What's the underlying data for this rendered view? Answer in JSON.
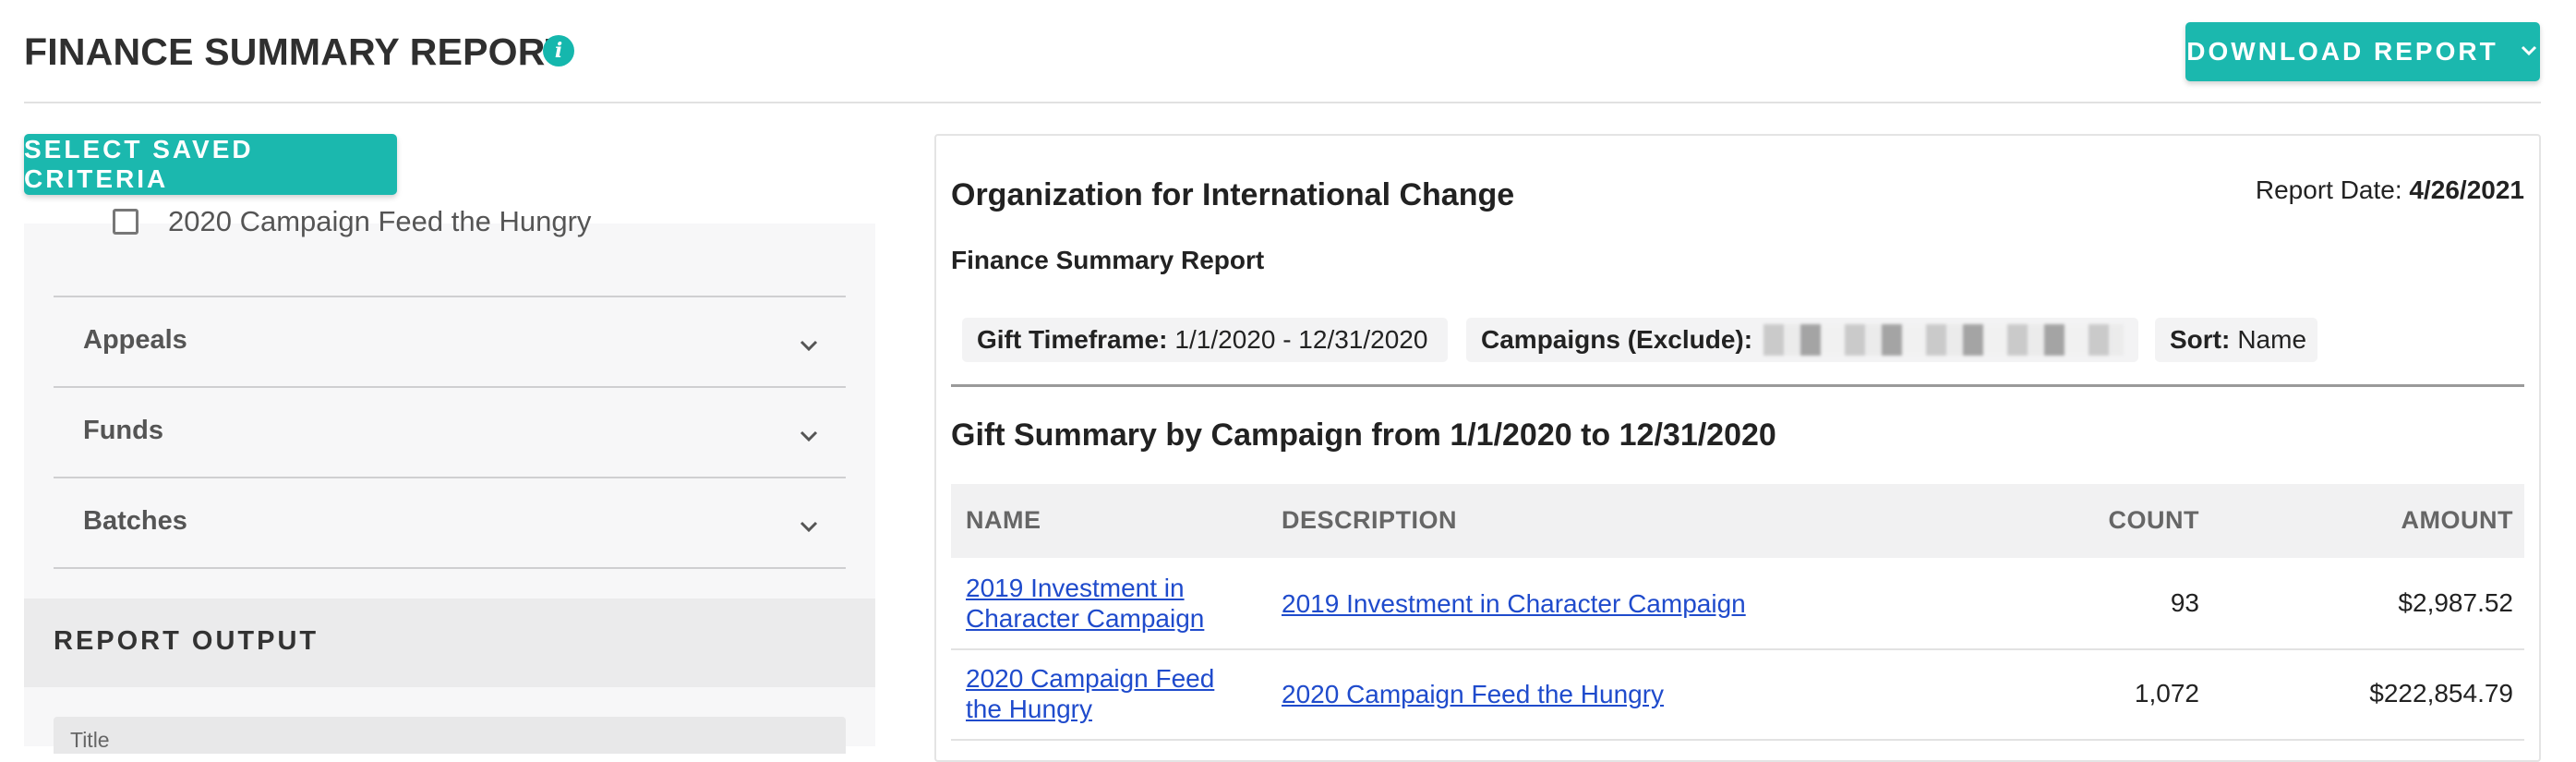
{
  "header": {
    "title": "FINANCE SUMMARY REPORT",
    "info_icon": "i",
    "download_label": "DOWNLOAD REPORT",
    "download_chevron": "⌄"
  },
  "left_panel": {
    "select_saved_label": "SELECT SAVED CRITERIA",
    "campaign_item": "2020 Campaign Feed the Hungry",
    "accordions": [
      "Appeals",
      "Funds",
      "Batches"
    ],
    "report_output_label": "REPORT OUTPUT",
    "title_field_label": "Title"
  },
  "report": {
    "org_name": "Organization for International Change",
    "report_date_label": "Report Date:",
    "report_date_value": "4/26/2021",
    "subtitle": "Finance Summary Report",
    "chips": {
      "timeframe_label": "Gift Timeframe:",
      "timeframe_value": "1/1/2020 - 12/31/2020",
      "campaigns_label": "Campaigns (Exclude):",
      "sort_label": "Sort:",
      "sort_value": "Name"
    },
    "section_title": "Gift Summary by Campaign from 1/1/2020 to 12/31/2020",
    "table": {
      "columns": [
        "NAME",
        "DESCRIPTION",
        "COUNT",
        "AMOUNT"
      ],
      "rows": [
        {
          "name_line1": "2019 Investment in",
          "name_line2": "Character Campaign",
          "description": "2019 Investment in Character Campaign",
          "count": "93",
          "amount": "$2,987.52"
        },
        {
          "name_line1": "2020 Campaign Feed",
          "name_line2": "the Hungry",
          "description": "2020 Campaign Feed the Hungry",
          "count": "1,072",
          "amount": "$222,854.79"
        }
      ]
    }
  },
  "colors": {
    "accent": "#1bb8ae",
    "link": "#1f4bcc"
  }
}
